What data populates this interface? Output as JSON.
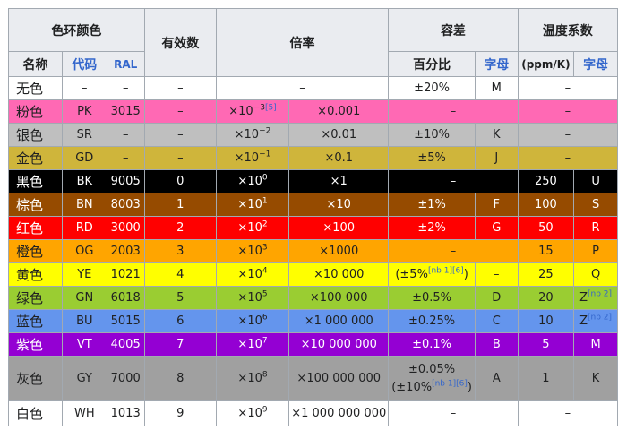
{
  "header": {
    "color_ring": "色环颜色",
    "sig_figs": "有效数",
    "multiplier": "倍率",
    "tolerance": "容差",
    "temp_coeff": "温度系数",
    "name": "名称",
    "code": "代码",
    "ral": "RAL",
    "percent": "百分比",
    "letter": "字母",
    "ppm": "(ppm/K)",
    "letter2": "字母"
  },
  "rows": [
    {
      "name": "无色",
      "code": "–",
      "ral": "–",
      "sig": "–",
      "mult_exp": "–",
      "mult_dec": "",
      "tol_pct": "±20%",
      "tol_letter": "M",
      "ppm": "–",
      "ppm_letter": "",
      "bg": "#ffffff",
      "fg": "#202122"
    },
    {
      "name": "粉色",
      "code": "PK",
      "ral": "3015",
      "sig": "–",
      "mult_exp": "×10",
      "mult_sup": "−3",
      "mult_ref": "[5]",
      "mult_dec": "×0.001",
      "tol_pct": "–",
      "tol_letter": "",
      "ppm": "–",
      "ppm_letter": "",
      "bg": "#ff69b4",
      "fg": "#202122"
    },
    {
      "name": "银色",
      "code": "SR",
      "ral": "–",
      "sig": "–",
      "mult_exp": "×10",
      "mult_sup": "−2",
      "mult_dec": "×0.01",
      "tol_pct": "±10%",
      "tol_letter": "K",
      "ppm": "–",
      "ppm_letter": "",
      "bg": "#bfbfbf",
      "fg": "#202122"
    },
    {
      "name": "金色",
      "code": "GD",
      "ral": "–",
      "sig": "–",
      "mult_exp": "×10",
      "mult_sup": "−1",
      "mult_dec": "×0.1",
      "tol_pct": "±5%",
      "tol_letter": "J",
      "ppm": "–",
      "ppm_letter": "",
      "bg": "#cfb53b",
      "fg": "#202122"
    },
    {
      "name": "黑色",
      "code": "BK",
      "ral": "9005",
      "sig": "0",
      "mult_exp": "×10",
      "mult_sup": "0",
      "mult_dec": "×1",
      "tol_pct": "–",
      "tol_letter": "",
      "ppm": "250",
      "ppm_letter": "U",
      "bg": "#000000",
      "fg": "#ffffff"
    },
    {
      "name": "棕色",
      "code": "BN",
      "ral": "8003",
      "sig": "1",
      "mult_exp": "×10",
      "mult_sup": "1",
      "mult_dec": "×10",
      "tol_pct": "±1%",
      "tol_letter": "F",
      "ppm": "100",
      "ppm_letter": "S",
      "bg": "#964b00",
      "fg": "#ffffff"
    },
    {
      "name": "红色",
      "code": "RD",
      "ral": "3000",
      "sig": "2",
      "mult_exp": "×10",
      "mult_sup": "2",
      "mult_dec": "×100",
      "tol_pct": "±2%",
      "tol_letter": "G",
      "ppm": "50",
      "ppm_letter": "R",
      "bg": "#ff0000",
      "fg": "#ffffff"
    },
    {
      "name": "橙色",
      "code": "OG",
      "ral": "2003",
      "sig": "3",
      "mult_exp": "×10",
      "mult_sup": "3",
      "mult_dec": "×1000",
      "tol_pct": "–",
      "tol_letter": "",
      "ppm": "15",
      "ppm_letter": "P",
      "bg": "#ffa500",
      "fg": "#202122"
    },
    {
      "name": "黄色",
      "code": "YE",
      "ral": "1021",
      "sig": "4",
      "mult_exp": "×10",
      "mult_sup": "4",
      "mult_dec": "×10 000",
      "tol_pct": "(±5%",
      "tol_ref": "[nb 1][6]",
      "tol_close": ")",
      "tol_letter": "–",
      "ppm": "25",
      "ppm_letter": "Q",
      "bg": "#ffff00",
      "fg": "#202122"
    },
    {
      "name": "绿色",
      "code": "GN",
      "ral": "6018",
      "sig": "5",
      "mult_exp": "×10",
      "mult_sup": "5",
      "mult_dec": "×100 000",
      "tol_pct": "±0.5%",
      "tol_letter": "D",
      "ppm": "20",
      "ppm_letter": "Z",
      "ppm_letter_ref": "[nb 2]",
      "bg": "#9acd32",
      "fg": "#202122"
    },
    {
      "name": "蓝色",
      "code": "BU",
      "ral": "5015",
      "sig": "6",
      "mult_exp": "×10",
      "mult_sup": "6",
      "mult_dec": "×1 000 000",
      "tol_pct": "±0.25%",
      "tol_letter": "C",
      "ppm": "10",
      "ppm_letter": "Z",
      "ppm_letter_ref": "[nb 2]",
      "bg": "#6495ed",
      "fg": "#202122"
    },
    {
      "name": "紫色",
      "code": "VT",
      "ral": "4005",
      "sig": "7",
      "mult_exp": "×10",
      "mult_sup": "7",
      "mult_dec": "×10 000 000",
      "tol_pct": "±0.1%",
      "tol_letter": "B",
      "ppm": "5",
      "ppm_letter": "M",
      "bg": "#9400d3",
      "fg": "#ffffff"
    },
    {
      "name": "灰色",
      "code": "GY",
      "ral": "7000",
      "sig": "8",
      "mult_exp": "×10",
      "mult_sup": "8",
      "mult_dec": "×100 000 000",
      "tol_pct": "±0.05%",
      "tol_line2": "(±10%",
      "tol_ref": "[nb 1][6]",
      "tol_close": ")",
      "tol_letter": "A",
      "ppm": "1",
      "ppm_letter": "K",
      "bg": "#a0a0a0",
      "fg": "#202122"
    },
    {
      "name": "白色",
      "code": "WH",
      "ral": "1013",
      "sig": "9",
      "mult_exp": "×10",
      "mult_sup": "9",
      "mult_dec": "×1 000 000 000",
      "tol_pct": "–",
      "tol_letter": "",
      "ppm": "–",
      "ppm_letter": "",
      "bg": "#ffffff",
      "fg": "#202122"
    }
  ]
}
